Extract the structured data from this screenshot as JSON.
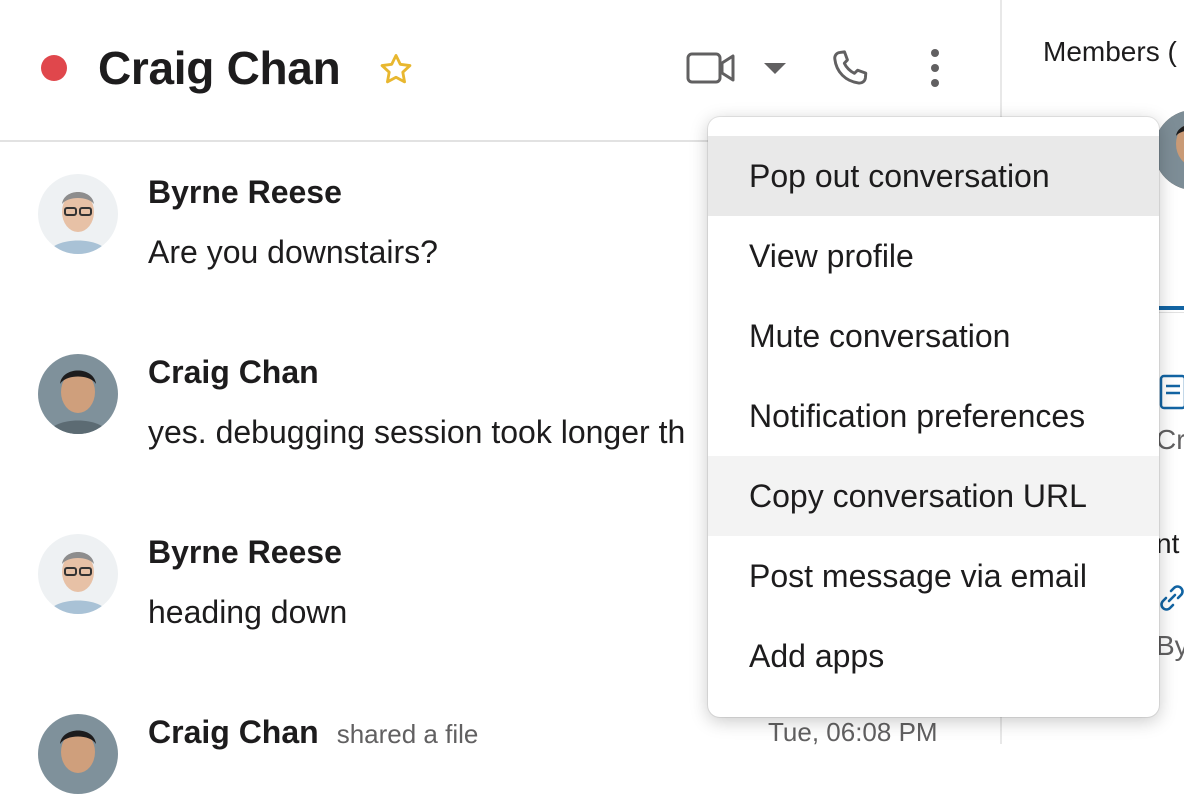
{
  "header": {
    "title": "Craig Chan",
    "presence_color": "#e0474c",
    "icons": [
      "star-icon",
      "video-icon",
      "chevron-down-icon",
      "phone-icon",
      "more-vertical-icon"
    ]
  },
  "side_panel": {
    "members_label": "Members (",
    "fragments": [
      "Cr",
      "nt",
      "By"
    ]
  },
  "messages": [
    {
      "sender": "Byrne Reese",
      "text": "Are you downstairs?"
    },
    {
      "sender": "Craig Chan",
      "text": "yes. debugging session took longer th"
    },
    {
      "sender": "Byrne Reese",
      "text": "heading down"
    },
    {
      "sender": "Craig Chan",
      "meta": "shared a file",
      "timestamp": "Tue, 06:08 PM"
    }
  ],
  "menu": {
    "items": [
      {
        "label": "Pop out conversation",
        "state": "active"
      },
      {
        "label": "View profile",
        "state": ""
      },
      {
        "label": "Mute conversation",
        "state": ""
      },
      {
        "label": "Notification preferences",
        "state": ""
      },
      {
        "label": "Copy conversation URL",
        "state": "hover"
      },
      {
        "label": "Post message via email",
        "state": ""
      },
      {
        "label": "Add apps",
        "state": ""
      }
    ]
  }
}
